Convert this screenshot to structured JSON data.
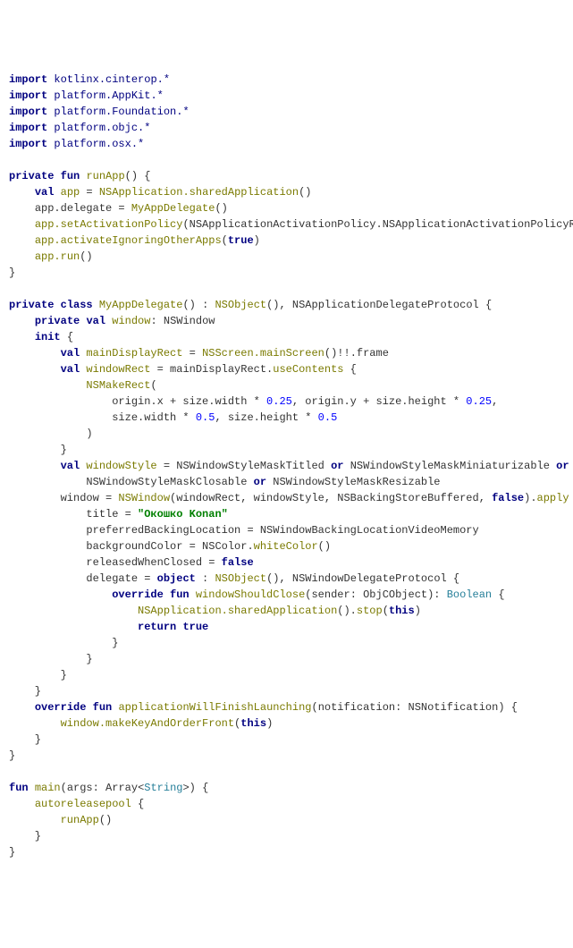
{
  "imports": {
    "kw": "import",
    "p1": "kotlinx.cinterop.*",
    "p2": "platform.AppKit.*",
    "p3": "platform.Foundation.*",
    "p4": "platform.objc.*",
    "p5": "platform.osx.*"
  },
  "kw": {
    "private": "private",
    "fun": "fun",
    "val": "val",
    "class": "class",
    "init": "init",
    "override": "override",
    "return": "return",
    "or": "or",
    "object": "object"
  },
  "runApp": {
    "name": "runApp",
    "app": "app",
    "ns_shared": "NSApplication.sharedApplication",
    "delegate": "app.delegate = ",
    "myAppDel": "MyAppDelegate",
    "setAct": "app.setActivationPolicy",
    "policy": "NSApplicationActivationPolicy.NSApplicationActivationPolicyRegular",
    "activate": "app.activateIgnoringOtherApps",
    "run": "app.run"
  },
  "cls": {
    "name": "MyAppDelegate",
    "extends": "NSObject",
    "proto": "NSApplicationDelegateProtocol",
    "window_decl": "window",
    "window_type": "NSWindow",
    "mainRect": "mainDisplayRect",
    "nsscreen": "NSScreen.mainScreen",
    "frame": ".frame",
    "windowRect": "windowRect",
    "useContents": "useContents",
    "nsMakeRect": "NSMakeRect",
    "rect_line1a": "origin.x + size.width * ",
    "rect_line1b": ", origin.y + size.height * ",
    "rect_line2a": "size.width * ",
    "rect_line2b": ", size.height * ",
    "num025": "0.25",
    "num05": "0.5",
    "windowStyle": "windowStyle",
    "style1": "NSWindowStyleMaskTitled",
    "style2": "NSWindowStyleMaskMiniaturizable",
    "style3": "NSWindowStyleMaskClosable",
    "style4": "NSWindowStyleMaskResizable",
    "window_assign": "window = ",
    "nswindow": "NSWindow",
    "backing": "NSBackingStoreBuffered",
    "apply": "apply",
    "title_lhs": "title = ",
    "title_str": "\"Окошко Konan\"",
    "pbl_lhs": "preferredBackingLocation = NSWindowBackingLocationVideoMemory",
    "bg_lhs": "backgroundColor = NSColor.",
    "whiteColor": "whiteColor",
    "rwc_lhs": "releasedWhenClosed = ",
    "del_lhs": "delegate = ",
    "del_proto": "NSWindowDelegateProtocol",
    "wsc": "windowShouldClose",
    "sender": "sender",
    "objc": "ObjCObject",
    "bool": "Boolean",
    "nsapp_stop": "NSApplication.sharedApplication",
    "stop": "stop",
    "this": "this",
    "awfl": "applicationWillFinishLaunching",
    "notif": "notification",
    "nsnotif": "NSNotification",
    "makeKey": "window.makeKeyAndOrderFront"
  },
  "main": {
    "name": "main",
    "args": "args",
    "arr": "Array",
    "str": "String",
    "autorel": "autoreleasepool",
    "runApp": "runApp"
  },
  "bool": {
    "true": "true",
    "false": "false"
  }
}
